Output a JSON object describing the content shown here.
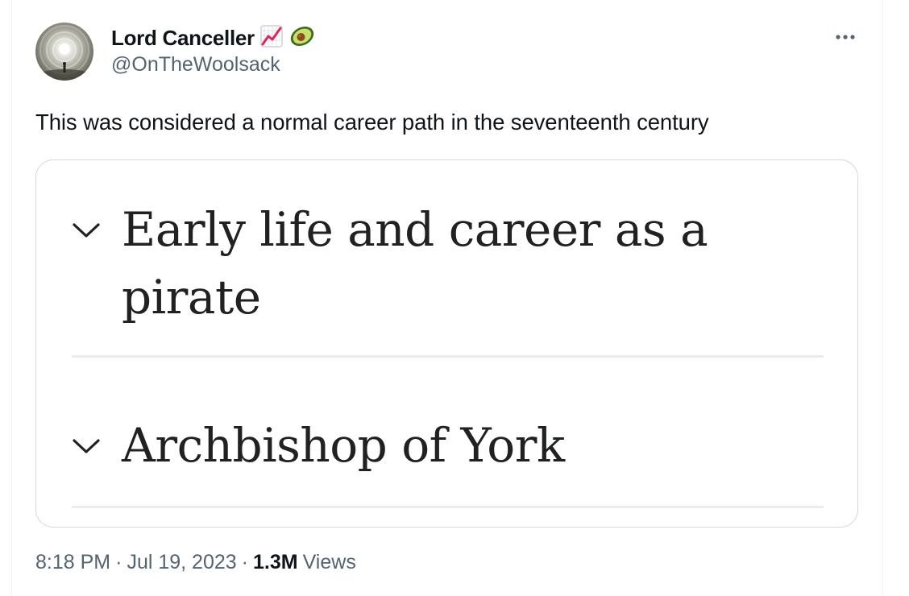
{
  "author": {
    "display_name": "Lord Canceller",
    "handle": "@OnTheWoolsack",
    "name_emojis": [
      "chart-increasing-icon",
      "avocado-icon"
    ]
  },
  "tweet": {
    "text": "This was considered a normal career path in the seventeenth century",
    "more_icon": "more-options-icon"
  },
  "media": {
    "sections": [
      {
        "title_line1": "Early life and career as a",
        "title_line2": "pirate",
        "icon": "chevron-down-icon"
      },
      {
        "title_line1": "Archbishop of York",
        "icon": "chevron-down-icon"
      }
    ]
  },
  "meta": {
    "time": "8:18 PM",
    "separator": "·",
    "date": "Jul 19, 2023",
    "views_count": "1.3M",
    "views_label": "Views"
  },
  "colors": {
    "text_primary": "#0f1419",
    "text_secondary": "#536471",
    "card_border": "#cfd9de",
    "wiki_text": "#202122",
    "wiki_divider": "#eaecf0"
  }
}
